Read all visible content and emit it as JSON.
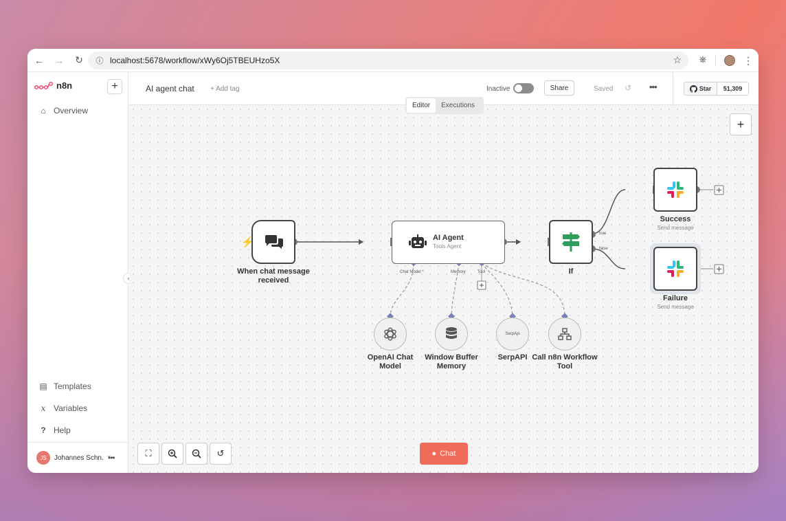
{
  "browser": {
    "url": "localhost:5678/workflow/xWy6Oj5TBEUHzo5X"
  },
  "sidebar": {
    "logo_text": "n8n",
    "items": [
      {
        "label": "Overview",
        "icon": "home-icon"
      },
      {
        "label": "Templates",
        "icon": "templates-icon"
      },
      {
        "label": "Variables",
        "icon": "variables-icon"
      },
      {
        "label": "Help",
        "icon": "help-icon"
      }
    ],
    "user": {
      "initials": "JS",
      "name": "Johannes Schn..."
    }
  },
  "header": {
    "workflow_name": "AI agent chat",
    "add_tag": "+ Add tag",
    "active_label": "Inactive",
    "share": "Share",
    "saved": "Saved",
    "github_star": "Star",
    "github_count": "51,309"
  },
  "canvas": {
    "tabs": [
      "Editor",
      "Executions"
    ],
    "active_tab": "Editor",
    "chat_button": "Chat"
  },
  "nodes": {
    "trigger": {
      "label": "When chat message received"
    },
    "agent": {
      "title": "AI Agent",
      "subtitle": "Tools Agent",
      "ports": {
        "chat_model": "Chat Model *",
        "memory": "Memory",
        "tool": "Tool"
      }
    },
    "if": {
      "label": "If",
      "true_label": "true",
      "false_label": "false"
    },
    "success": {
      "label": "Success",
      "subtitle": "Send message"
    },
    "failure": {
      "label": "Failure",
      "subtitle": "Send message"
    },
    "openai": {
      "label": "OpenAI Chat Model"
    },
    "memory": {
      "label": "Window Buffer Memory"
    },
    "serpapi": {
      "label": "SerpAPI",
      "icon_text": "SerpApi"
    },
    "workflow_tool": {
      "label": "Call n8n Workflow Tool"
    }
  },
  "colors": {
    "accent": "#f16b5a",
    "trigger_bolt": "#f16b5a",
    "if_green": "#2e9e5b"
  }
}
